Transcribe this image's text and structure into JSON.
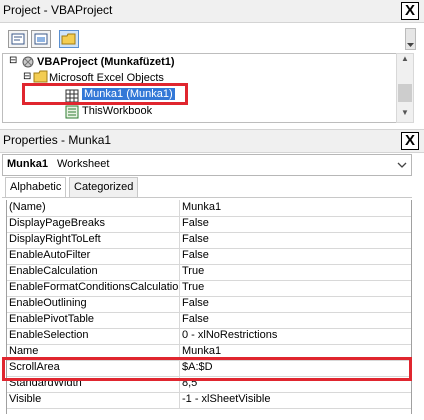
{
  "project_window": {
    "title": "Project - VBAProject",
    "close_symbol": "X",
    "toolbar": [
      "view-code-icon",
      "view-object-icon",
      "toggle-folders-icon"
    ],
    "tree": {
      "project": "VBAProject (Munkafüzet1)",
      "folder": "Microsoft Excel Objects",
      "selected_item": "Munka1 (Munka1)",
      "item2": "ThisWorkbook"
    }
  },
  "properties_window": {
    "title": "Properties - Munka1",
    "close_symbol": "X",
    "object": {
      "name": "Munka1",
      "type": "Worksheet"
    },
    "tabs": [
      "Alphabetic",
      "Categorized"
    ],
    "rows": [
      {
        "name": "(Name)",
        "value": "Munka1"
      },
      {
        "name": "DisplayPageBreaks",
        "value": "False"
      },
      {
        "name": "DisplayRightToLeft",
        "value": "False"
      },
      {
        "name": "EnableAutoFilter",
        "value": "False"
      },
      {
        "name": "EnableCalculation",
        "value": "True"
      },
      {
        "name": "EnableFormatConditionsCalculation",
        "value": "True"
      },
      {
        "name": "EnableOutlining",
        "value": "False"
      },
      {
        "name": "EnablePivotTable",
        "value": "False"
      },
      {
        "name": "EnableSelection",
        "value": "0 - xlNoRestrictions"
      },
      {
        "name": "Name",
        "value": "Munka1"
      },
      {
        "name": "ScrollArea",
        "value": "$A:$D"
      },
      {
        "name": "StandardWidth",
        "value": "8,5"
      },
      {
        "name": "Visible",
        "value": "-1 - xlSheetVisible"
      }
    ]
  },
  "highlight_color": "#e0262f"
}
